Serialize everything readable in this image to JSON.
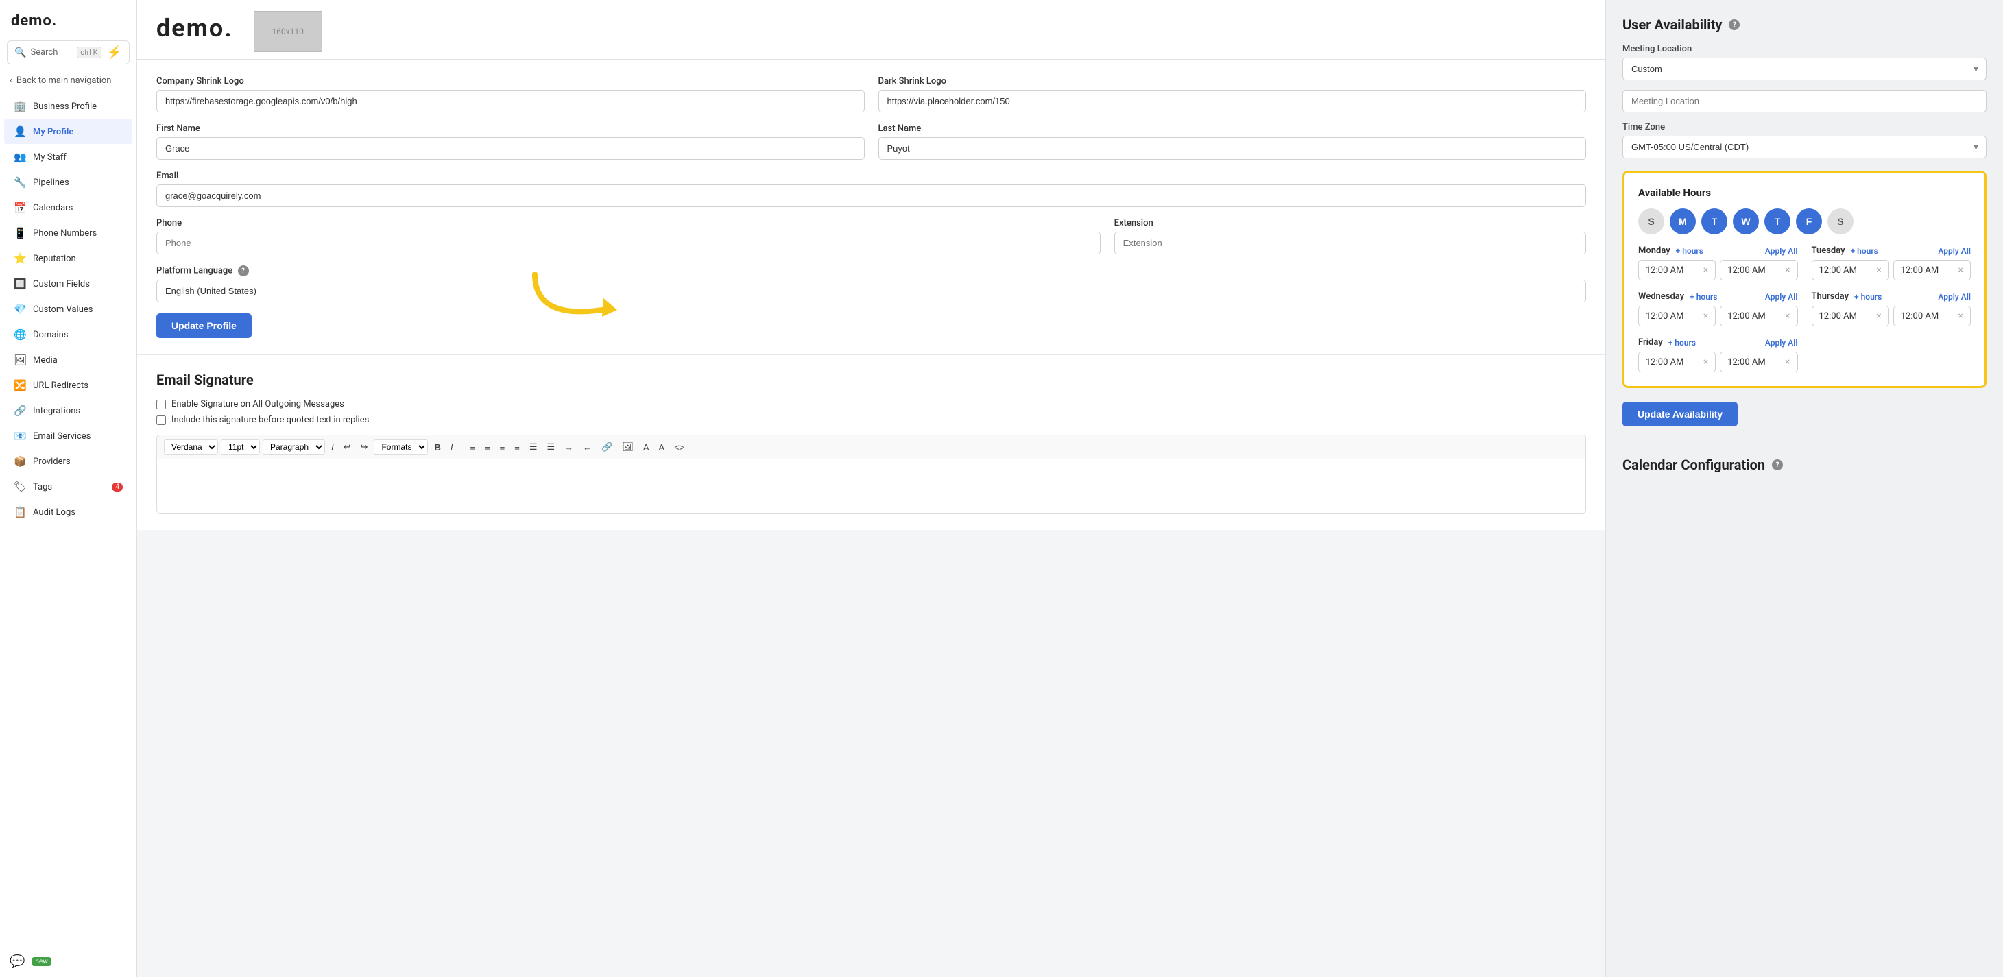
{
  "app": {
    "logo": "demo.",
    "search_label": "Search",
    "search_kbd": "ctrl K"
  },
  "sidebar": {
    "back_label": "Back to main navigation",
    "items": [
      {
        "id": "business-profile",
        "label": "Business Profile",
        "icon": "🏢",
        "active": false
      },
      {
        "id": "my-profile",
        "label": "My Profile",
        "icon": "👤",
        "active": true
      },
      {
        "id": "my-staff",
        "label": "My Staff",
        "icon": "👥",
        "active": false
      },
      {
        "id": "pipelines",
        "label": "Pipelines",
        "icon": "🔧",
        "active": false
      },
      {
        "id": "calendars",
        "label": "Calendars",
        "icon": "📅",
        "active": false
      },
      {
        "id": "phone-numbers",
        "label": "Phone Numbers",
        "icon": "📱",
        "active": false
      },
      {
        "id": "reputation",
        "label": "Reputation",
        "icon": "⭐",
        "active": false
      },
      {
        "id": "custom-fields",
        "label": "Custom Fields",
        "icon": "🔲",
        "active": false
      },
      {
        "id": "custom-values",
        "label": "Custom Values",
        "icon": "💎",
        "active": false
      },
      {
        "id": "domains",
        "label": "Domains",
        "icon": "🌐",
        "active": false
      },
      {
        "id": "media",
        "label": "Media",
        "icon": "🖼",
        "active": false
      },
      {
        "id": "url-redirects",
        "label": "URL Redirects",
        "icon": "🔀",
        "active": false
      },
      {
        "id": "integrations",
        "label": "Integrations",
        "icon": "🔗",
        "active": false
      },
      {
        "id": "email-services",
        "label": "Email Services",
        "icon": "📧",
        "active": false
      },
      {
        "id": "providers",
        "label": "Providers",
        "icon": "📦",
        "active": false
      },
      {
        "id": "tags",
        "label": "Tags",
        "icon": "🏷",
        "active": false,
        "badge": "4"
      },
      {
        "id": "audit-logs",
        "label": "Audit Logs",
        "icon": "📋",
        "active": false
      }
    ]
  },
  "chat_badge": "new",
  "center": {
    "logo_text": "demo.",
    "logo_img_placeholder": "160x110",
    "company_shrink_logo_label": "Company Shrink Logo",
    "company_shrink_logo_value": "https://firebasestorage.googleapis.com/v0/b/high",
    "dark_shrink_logo_label": "Dark Shrink Logo",
    "dark_shrink_logo_value": "https://via.placeholder.com/150",
    "first_name_label": "First Name",
    "first_name_value": "Grace",
    "last_name_label": "Last Name",
    "last_name_value": "Puyot",
    "email_label": "Email",
    "email_value": "grace@goacquirely.com",
    "phone_label": "Phone",
    "phone_placeholder": "Phone",
    "extension_label": "Extension",
    "extension_placeholder": "Extension",
    "platform_language_label": "Platform Language",
    "platform_language_value": "English (United States)",
    "update_profile_btn": "Update Profile",
    "email_signature_title": "Email Signature",
    "sig_checkbox1": "Enable Signature on All Outgoing Messages",
    "sig_checkbox2": "Include this signature before quoted text in replies",
    "editor_font": "Verdana",
    "editor_size": "11pt",
    "editor_paragraph": "Paragraph",
    "editor_formats": "Formats"
  },
  "right": {
    "user_availability_title": "User Availability",
    "meeting_location_label": "Meeting Location",
    "meeting_location_value": "Custom",
    "meeting_location_placeholder": "Meeting Location",
    "time_zone_label": "Time Zone",
    "time_zone_value": "GMT-05:00 US/Central (CDT)",
    "available_hours_title": "Available Hours",
    "days": [
      {
        "label": "S",
        "active": false
      },
      {
        "label": "M",
        "active": true
      },
      {
        "label": "T",
        "active": true
      },
      {
        "label": "W",
        "active": true
      },
      {
        "label": "T",
        "active": true
      },
      {
        "label": "F",
        "active": true
      },
      {
        "label": "S",
        "active": false
      }
    ],
    "hours_rows": [
      {
        "day": "Monday",
        "from": "12:00 AM",
        "to": "12:00 AM"
      },
      {
        "day": "Tuesday",
        "from": "12:00 AM",
        "to": "12:00 AM"
      },
      {
        "day": "Wednesday",
        "from": "12:00 AM",
        "to": "12:00 AM"
      },
      {
        "day": "Thursday",
        "from": "12:00 AM",
        "to": "12:00 AM"
      },
      {
        "day": "Friday",
        "from": "12:00 AM",
        "to": "12:00 AM"
      }
    ],
    "add_hours_label": "+ hours",
    "apply_all_label": "Apply All",
    "update_availability_btn": "Update Availability",
    "calendar_config_title": "Calendar Configuration"
  }
}
